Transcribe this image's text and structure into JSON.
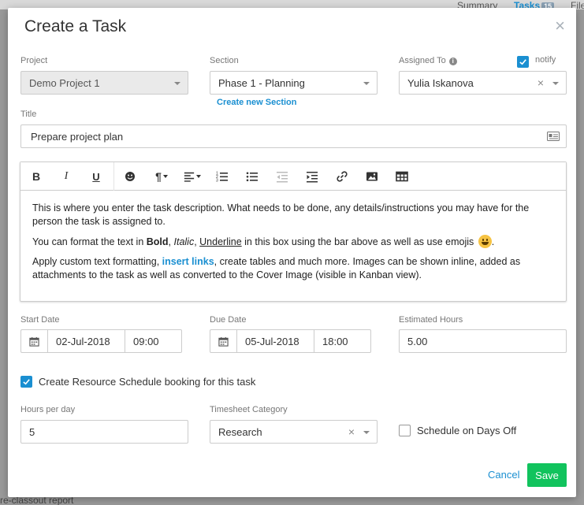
{
  "background": {
    "tabs": [
      {
        "label": "Summary"
      },
      {
        "label": "Tasks",
        "badge": "15"
      },
      {
        "label": "File"
      }
    ],
    "bottom_text": "re-classout report"
  },
  "modal": {
    "title": "Create a Task",
    "close_symbol": "×"
  },
  "project": {
    "label": "Project",
    "value": "Demo Project 1"
  },
  "section": {
    "label": "Section",
    "value": "Phase 1 - Planning",
    "create_link": "Create new Section"
  },
  "assigned_to": {
    "label": "Assigned To",
    "value": "Yulia Iskanova",
    "clear_symbol": "×",
    "notify_label": "notify",
    "notify_checked": true
  },
  "title_field": {
    "label": "Title",
    "value": "Prepare project plan"
  },
  "toolbar": {
    "bold": "B",
    "italic": "I",
    "underline": "U",
    "paragraph": "¶"
  },
  "editor": {
    "p1": "This is where you enter the task description. What needs to be done, any details/instructions you may have for the person the task is assigned to.",
    "p2_a": "You can format the text in ",
    "p2_bold": "Bold",
    "p2_sep1": ", ",
    "p2_italic": "Italic",
    "p2_sep2": ", ",
    "p2_underline": "Underline",
    "p2_b": " in this box using the bar above as well as use emojis ",
    "p2_end": ".",
    "p3_a": "Apply custom text formatting, ",
    "p3_link": "insert links",
    "p3_b": ", create tables and much more. Images can be shown inline, added as attachments to the task as well as converted to the Cover Image (visible in Kanban view)."
  },
  "start_date": {
    "label": "Start Date",
    "date": "02-Jul-2018",
    "time": "09:00"
  },
  "due_date": {
    "label": "Due Date",
    "date": "05-Jul-2018",
    "time": "18:00"
  },
  "estimated_hours": {
    "label": "Estimated Hours",
    "value": "5.00"
  },
  "resource_booking": {
    "label": "Create Resource Schedule booking for this task",
    "checked": true
  },
  "hours_per_day": {
    "label": "Hours per day",
    "value": "5"
  },
  "timesheet_category": {
    "label": "Timesheet Category",
    "value": "Research",
    "clear_symbol": "×"
  },
  "schedule_days_off": {
    "label": "Schedule on Days Off",
    "checked": false
  },
  "actions": {
    "cancel": "Cancel",
    "save": "Save"
  },
  "colors": {
    "accent": "#1a8fd1",
    "save": "#11c35d"
  }
}
